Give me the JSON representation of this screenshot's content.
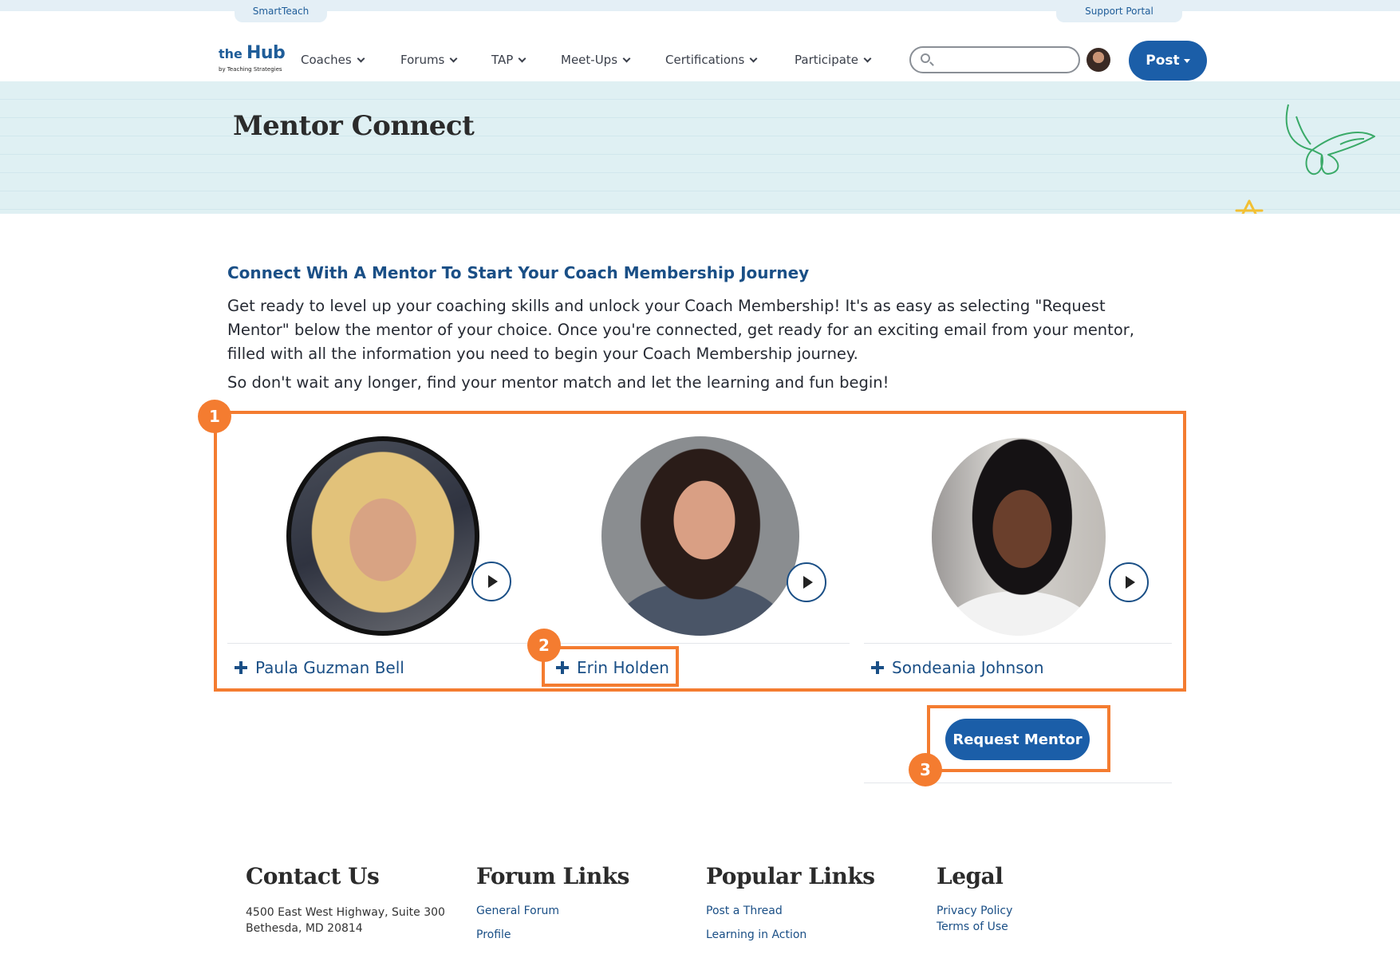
{
  "top_tabs": {
    "left": "SmartTeach",
    "right": "Support Portal"
  },
  "logo": {
    "the": "the",
    "hub": "Hub",
    "by": "by Teaching Strategies"
  },
  "nav": [
    {
      "label": "Coaches"
    },
    {
      "label": "Forums"
    },
    {
      "label": "TAP"
    },
    {
      "label": "Meet-Ups"
    },
    {
      "label": "Certifications"
    },
    {
      "label": "Participate"
    }
  ],
  "search": {
    "placeholder": "",
    "value": ""
  },
  "post_button": {
    "label": "Post"
  },
  "hero": {
    "title": "Mentor Connect"
  },
  "intro": {
    "heading": "Connect With A Mentor To Start Your Coach Membership Journey",
    "body": "Get ready to level up your coaching skills and unlock your Coach Membership! It's as easy as selecting \"Request Mentor\" below the mentor of your choice. Once you're connected, get ready for an exciting email from your mentor, filled with all the information you need to begin your Coach Membership journey.",
    "cta": "So don't wait any longer, find your mentor match and let the learning and fun begin!"
  },
  "mentors": [
    {
      "name": "Paula Guzman Bell"
    },
    {
      "name": "Erin Holden"
    },
    {
      "name": "Sondeania Johnson"
    }
  ],
  "request_button": {
    "label": "Request Mentor"
  },
  "callouts": [
    "1",
    "2",
    "3"
  ],
  "footer": {
    "contact": {
      "title": "Contact Us",
      "address_line1": "4500 East West Highway, Suite 300",
      "address_line2": "Bethesda, MD 20814"
    },
    "forum": {
      "title": "Forum Links",
      "links": [
        "General Forum",
        "Profile"
      ]
    },
    "popular": {
      "title": "Popular Links",
      "links": [
        "Post a Thread",
        "Learning in Action"
      ]
    },
    "legal": {
      "title": "Legal",
      "links": [
        "Privacy Policy",
        "Terms of Use"
      ]
    }
  },
  "colors": {
    "brand_blue": "#1b5ea8",
    "link_blue": "#1a4f86",
    "callout_orange": "#f47c30",
    "hero_bg": "#dff0f3"
  }
}
